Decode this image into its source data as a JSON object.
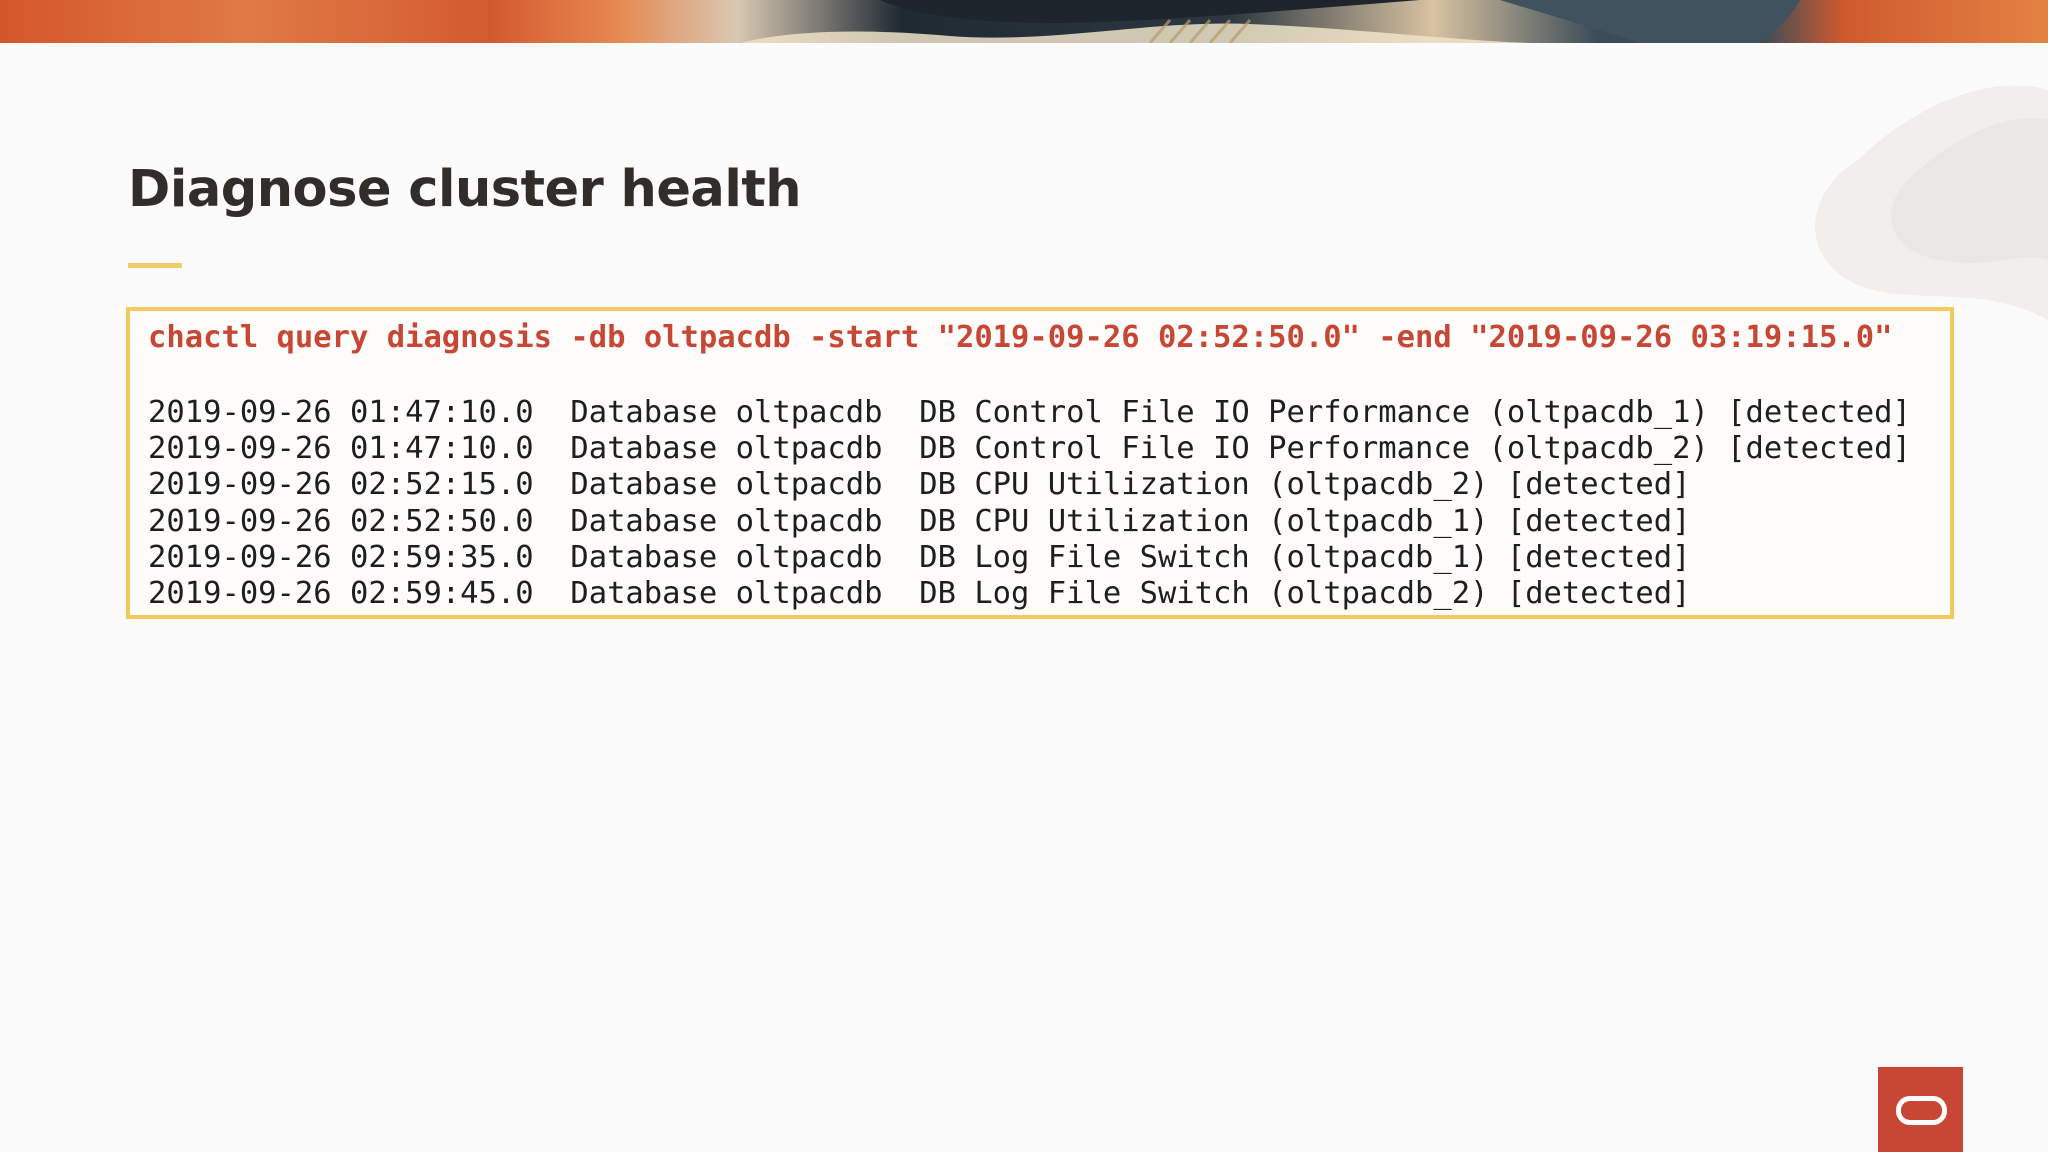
{
  "slide": {
    "title": "Diagnose cluster health",
    "accent_color": "#f0cc71",
    "brand_color": "#c74634"
  },
  "code": {
    "command": "chactl query diagnosis -db oltpacdb -start \"2019-09-26 02:52:50.0\" -end \"2019-09-26 03:19:15.0\"",
    "output": [
      "2019-09-26 01:47:10.0  Database oltpacdb  DB Control File IO Performance (oltpacdb_1) [detected]",
      "2019-09-26 01:47:10.0  Database oltpacdb  DB Control File IO Performance (oltpacdb_2) [detected]",
      "2019-09-26 02:52:15.0  Database oltpacdb  DB CPU Utilization (oltpacdb_2) [detected]",
      "2019-09-26 02:52:50.0  Database oltpacdb  DB CPU Utilization (oltpacdb_1) [detected]",
      "2019-09-26 02:59:35.0  Database oltpacdb  DB Log File Switch (oltpacdb_1) [detected]",
      "2019-09-26 02:59:45.0  Database oltpacdb  DB Log File Switch (oltpacdb_2) [detected]"
    ]
  },
  "logo": {
    "icon": "oracle-logo-icon"
  }
}
